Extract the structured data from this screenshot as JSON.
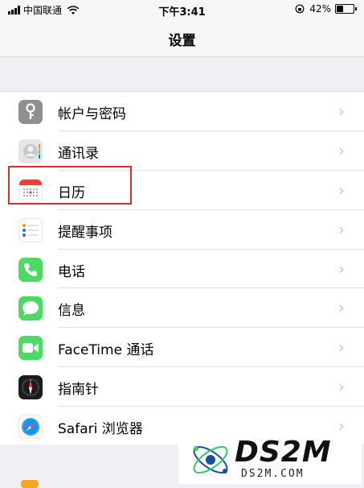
{
  "status_bar": {
    "carrier": "中国联通",
    "time": "下午3:41",
    "battery_percent_text": "42%",
    "battery_level": 0.42
  },
  "nav": {
    "title": "设置"
  },
  "rows": [
    {
      "label": "帐户与密码",
      "icon": "key-icon",
      "color": "#8e8e93"
    },
    {
      "label": "通讯录",
      "icon": "contacts-icon",
      "color": "#c7c7cc"
    },
    {
      "label": "日历",
      "icon": "calendar-icon",
      "color": "#ffffff"
    },
    {
      "label": "提醒事项",
      "icon": "reminders-icon",
      "color": "#ffffff"
    },
    {
      "label": "电话",
      "icon": "phone-icon",
      "color": "#4cd964"
    },
    {
      "label": "信息",
      "icon": "messages-icon",
      "color": "#4cd964"
    },
    {
      "label": "FaceTime 通话",
      "icon": "facetime-icon",
      "color": "#4cd964"
    },
    {
      "label": "指南针",
      "icon": "compass-icon",
      "color": "#1c1c1e"
    },
    {
      "label": "Safari 浏览器",
      "icon": "safari-icon",
      "color": "#ffffff"
    }
  ],
  "watermark": {
    "big": "DS2M",
    "small": "DS2M.COM"
  }
}
